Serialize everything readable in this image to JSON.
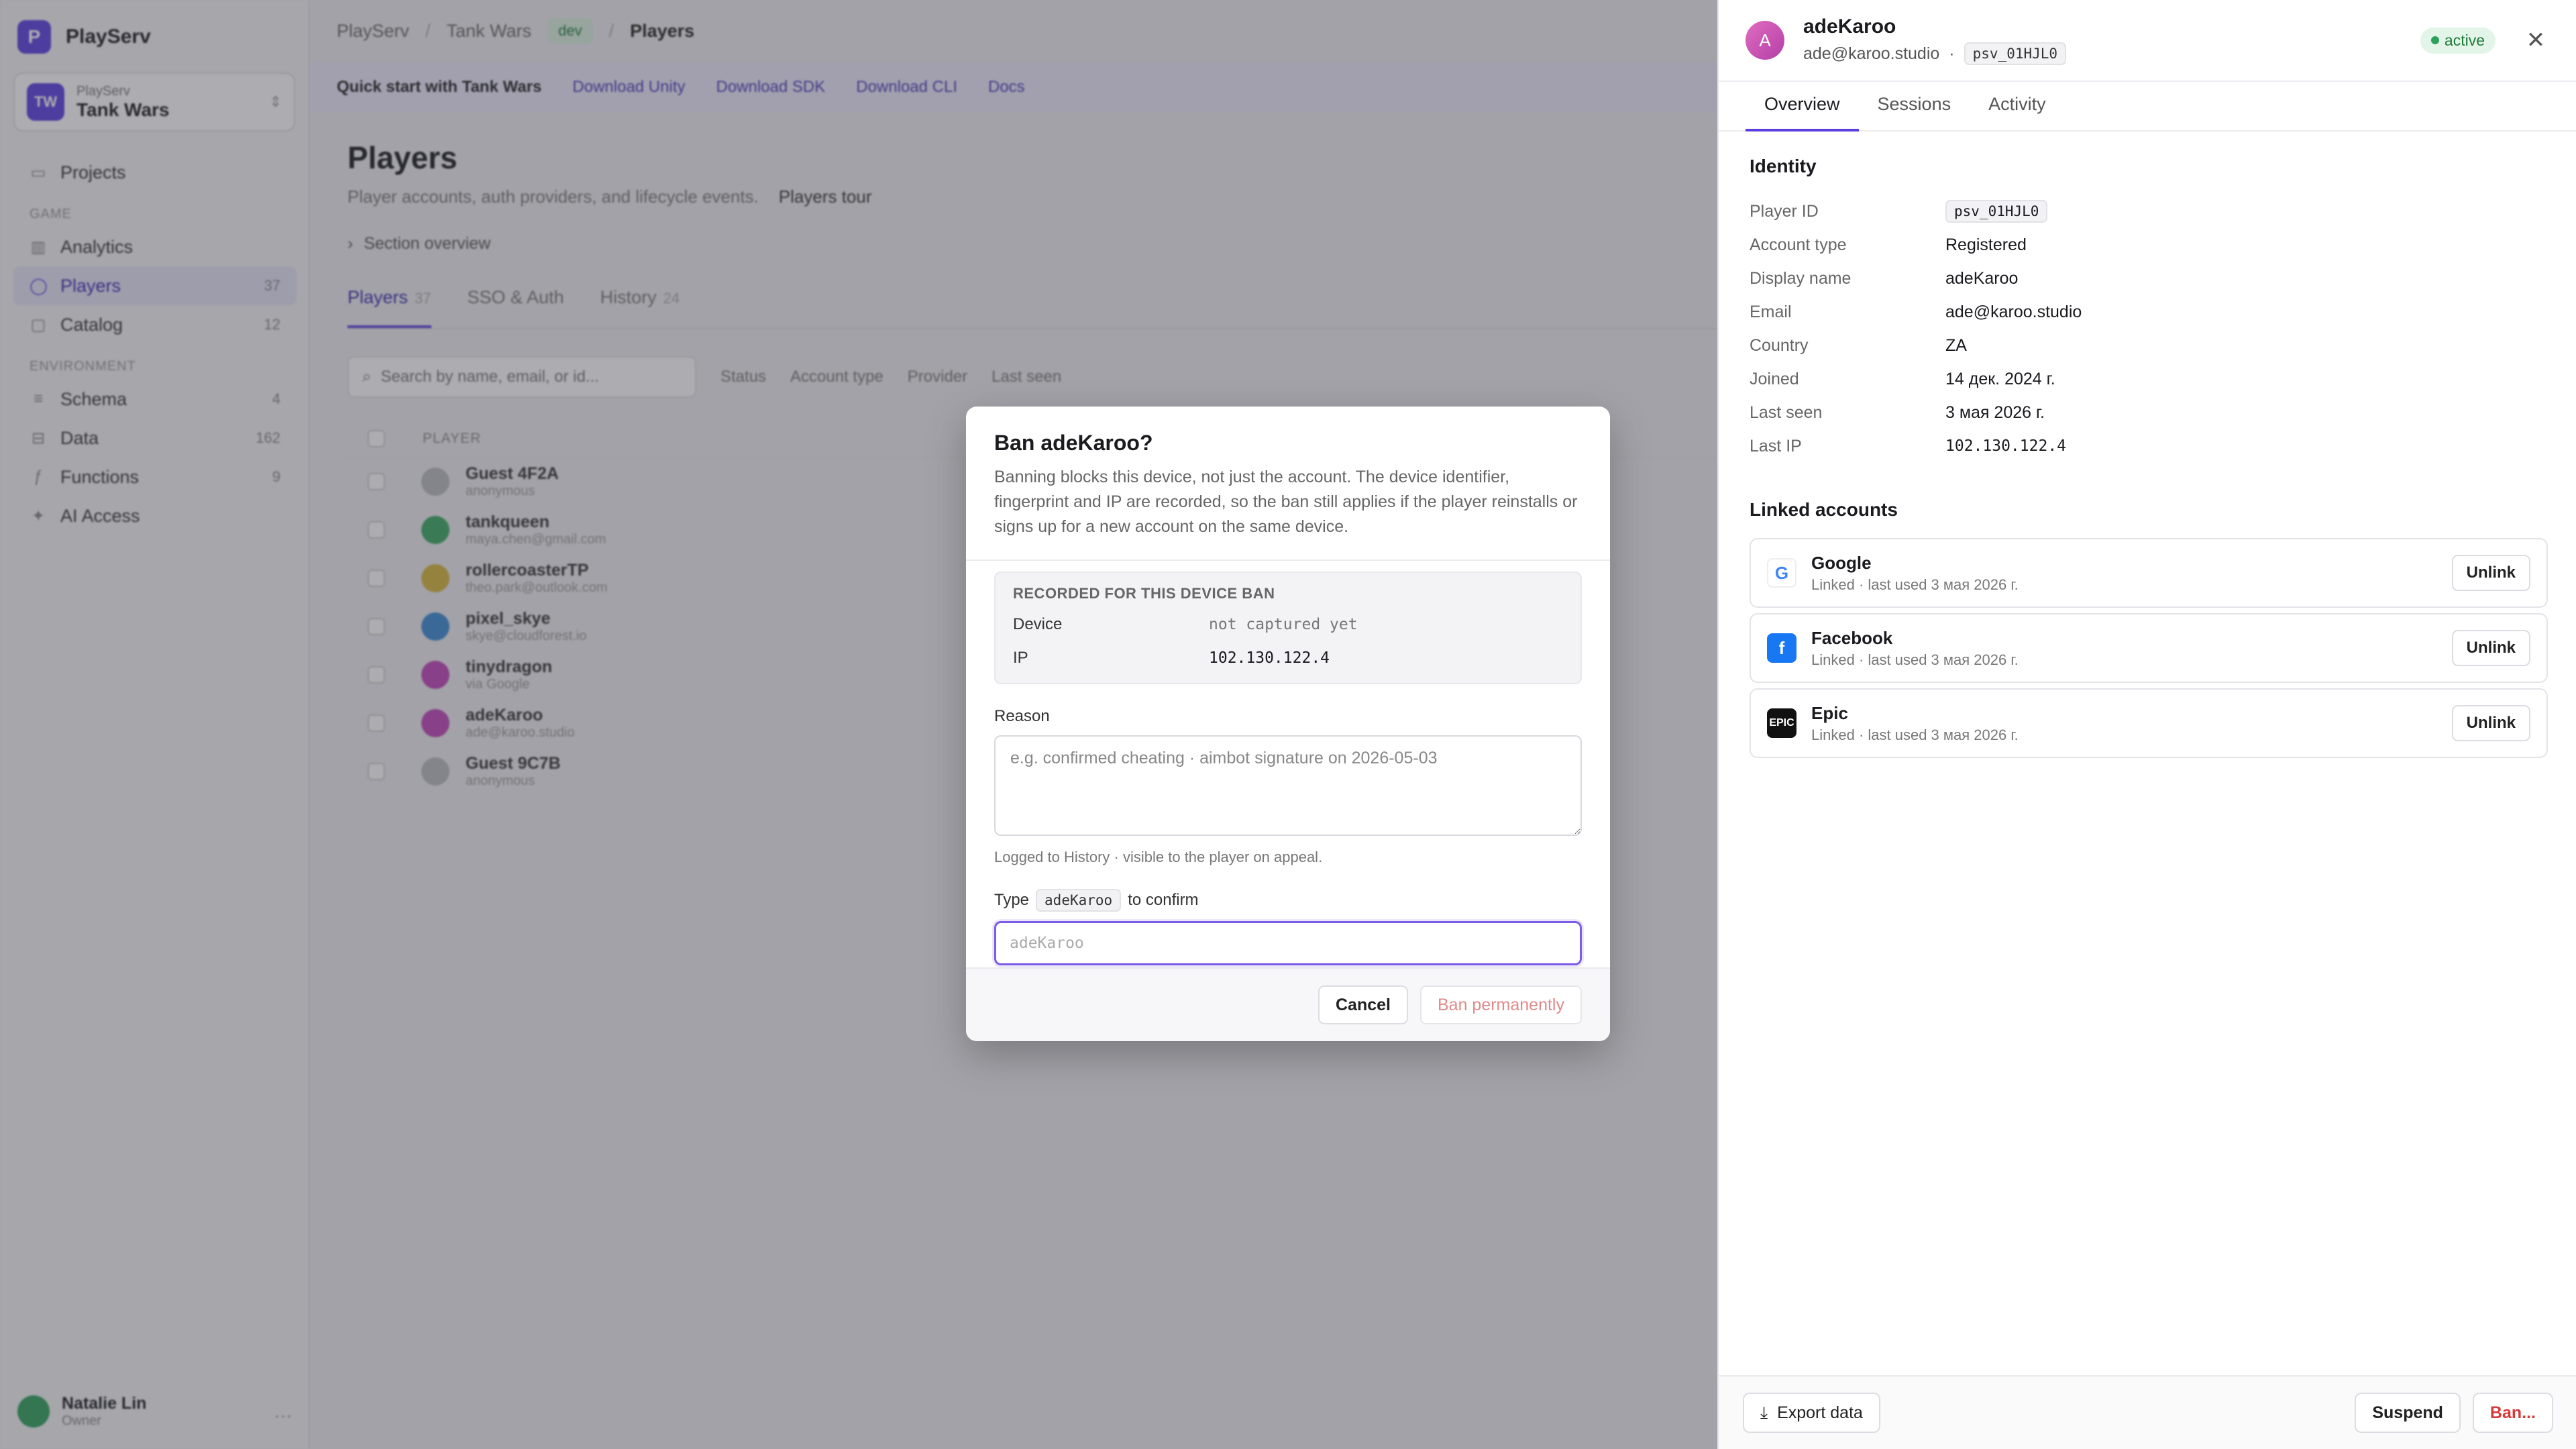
{
  "app": {
    "brand": "PlayServ",
    "project_org": "PlayServ",
    "project_name": "Tank Wars",
    "project_initials": "TW"
  },
  "sidebar": {
    "top_items": [
      {
        "label": "Projects",
        "icon": "folder-icon"
      }
    ],
    "section_game": "GAME",
    "game_items": [
      {
        "label": "Analytics",
        "count": ""
      },
      {
        "label": "Players",
        "count": "37"
      },
      {
        "label": "Catalog",
        "count": "12"
      }
    ],
    "section_env": "ENVIRONMENT",
    "env_items": [
      {
        "label": "Schema",
        "count": "4"
      },
      {
        "label": "Data",
        "count": "162"
      },
      {
        "label": "Functions",
        "count": "9"
      },
      {
        "label": "AI Access",
        "count": ""
      }
    ],
    "user_name": "Natalie Lin",
    "user_role": "Owner"
  },
  "topbar": {
    "crumb1": "PlayServ",
    "crumb2": "Tank Wars",
    "env": "dev",
    "crumb3": "Players"
  },
  "banner": {
    "quickstart": "Quick start with Tank Wars",
    "items": [
      "Download Unity",
      "Download SDK",
      "Download CLI",
      "Docs"
    ]
  },
  "page": {
    "title": "Players",
    "subtitle": "Player accounts, auth providers, and lifecycle events.",
    "tour": "Players tour",
    "section_overview": "Section overview",
    "tabs": [
      {
        "label": "Players",
        "count": "37"
      },
      {
        "label": "SSO & Auth",
        "count": ""
      },
      {
        "label": "History",
        "count": "24"
      }
    ],
    "search_placeholder": "Search by name, email, or id...",
    "filters": [
      "Status",
      "Account type",
      "Provider",
      "Last seen"
    ],
    "col_player": "PLAYER",
    "rows": [
      {
        "name": "Guest 4F2A",
        "sub": "anonymous",
        "color": "#b8b8be"
      },
      {
        "name": "tankqueen",
        "sub": "maya.chen@gmail.com",
        "color": "#3aa860"
      },
      {
        "name": "rollercoasterTP",
        "sub": "theo.park@outlook.com",
        "color": "#d4b63a"
      },
      {
        "name": "pixel_skye",
        "sub": "skye@cloudforest.io",
        "color": "#3a8ad4"
      },
      {
        "name": "tinydragon",
        "sub": "via Google",
        "color": "#c044b8"
      },
      {
        "name": "adeKaroo",
        "sub": "ade@karoo.studio",
        "color": "#c044b8"
      },
      {
        "name": "Guest 9C7B",
        "sub": "anonymous",
        "color": "#b8b8be"
      }
    ]
  },
  "drawer": {
    "avatar_letter": "A",
    "name": "adeKaroo",
    "email": "ade@karoo.studio",
    "id_chip": "psv_01HJL0",
    "status": "active",
    "tabs": [
      "Overview",
      "Sessions",
      "Activity"
    ],
    "identity_title": "Identity",
    "identity": [
      {
        "key": "Player ID",
        "value": "psv_01HJL0",
        "chip": true
      },
      {
        "key": "Account type",
        "value": "Registered"
      },
      {
        "key": "Display name",
        "value": "adeKaroo"
      },
      {
        "key": "Email",
        "value": "ade@karoo.studio"
      },
      {
        "key": "Country",
        "value": "ZA"
      },
      {
        "key": "Joined",
        "value": "14 дек. 2024 г."
      },
      {
        "key": "Last seen",
        "value": "3 мая 2026 г."
      },
      {
        "key": "Last IP",
        "value": "102.130.122.4",
        "mono": true
      }
    ],
    "linked_title": "Linked accounts",
    "linked": [
      {
        "name": "Google",
        "sub": "Linked · last used 3 мая 2026 г.",
        "icon": "google-icon",
        "glyph": "G",
        "cls": "g"
      },
      {
        "name": "Facebook",
        "sub": "Linked · last used 3 мая 2026 г.",
        "icon": "facebook-icon",
        "glyph": "f",
        "cls": "f"
      },
      {
        "name": "Epic",
        "sub": "Linked · last used 3 мая 2026 г.",
        "icon": "epic-icon",
        "glyph": "EPIC",
        "cls": "e"
      }
    ],
    "unlink_label": "Unlink",
    "export_label": "Export data",
    "suspend_label": "Suspend",
    "ban_label": "Ban..."
  },
  "modal": {
    "title": "Ban adeKaroo?",
    "description": "Banning blocks this device, not just the account. The device identifier, fingerprint and IP are recorded, so the ban still applies if the player reinstalls or signs up for a new account on the same device.",
    "recorded_title": "RECORDED FOR THIS DEVICE BAN",
    "device_label": "Device",
    "device_value": "not captured yet",
    "ip_label": "IP",
    "ip_value": "102.130.122.4",
    "reason_label": "Reason",
    "reason_placeholder": "e.g. confirmed cheating · aimbot signature on 2026-05-03",
    "hint": "Logged to History · visible to the player on appeal.",
    "type_prefix": "Type",
    "type_token": "adeKaroo",
    "type_suffix": "to confirm",
    "confirm_placeholder": "adeKaroo",
    "cancel_label": "Cancel",
    "ban_label": "Ban permanently"
  }
}
